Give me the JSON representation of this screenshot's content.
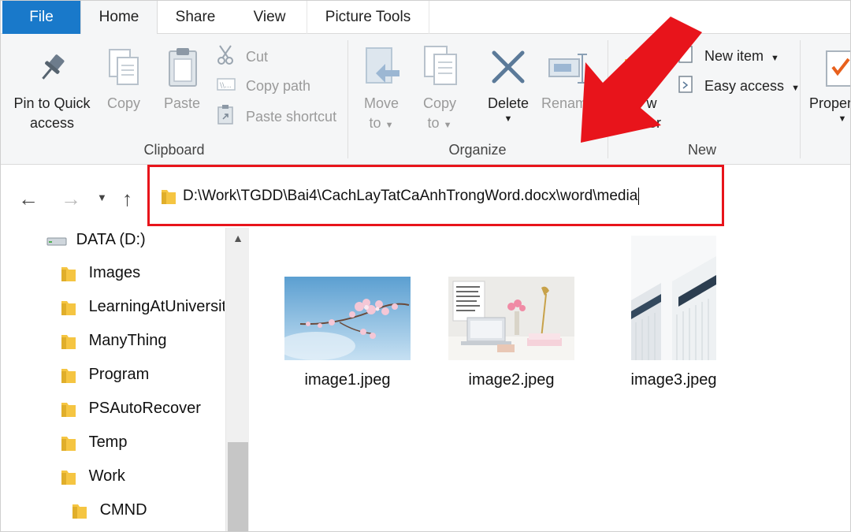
{
  "tabs": {
    "file": "File",
    "home": "Home",
    "share": "Share",
    "view": "View",
    "picture_tools": "Picture Tools"
  },
  "ribbon": {
    "clipboard": {
      "group_label": "Clipboard",
      "pin_line1": "Pin to Quick",
      "pin_line2": "access",
      "copy": "Copy",
      "paste": "Paste",
      "cut": "Cut",
      "copy_path": "Copy path",
      "paste_shortcut": "Paste shortcut"
    },
    "organize": {
      "group_label": "Organize",
      "move_line1": "Move",
      "move_line2": "to",
      "copy_line1": "Copy",
      "copy_line2": "to",
      "delete": "Delete",
      "rename": "Renam"
    },
    "new": {
      "group_label": "New",
      "new_folder_line1": "w",
      "new_folder_line2": "der",
      "new_item": "New item",
      "easy_access": "Easy access"
    },
    "open": {
      "properties": "Proper"
    }
  },
  "address": {
    "path": "D:\\Work\\TGDD\\Bai4\\CachLayTatCaAnhTrongWord.docx\\word\\media"
  },
  "nav_tree": [
    {
      "label": "DATA (D:)",
      "icon": "drive-icon"
    },
    {
      "label": "Images",
      "icon": "folder-icon"
    },
    {
      "label": "LearningAtUniversity",
      "icon": "folder-icon"
    },
    {
      "label": "ManyThing",
      "icon": "folder-icon"
    },
    {
      "label": "Program",
      "icon": "folder-icon"
    },
    {
      "label": "PSAutoRecover",
      "icon": "folder-icon"
    },
    {
      "label": "Temp",
      "icon": "folder-icon"
    },
    {
      "label": "Work",
      "icon": "folder-icon"
    },
    {
      "label": "CMND",
      "icon": "folder-icon"
    }
  ],
  "files": [
    {
      "name": "image1.jpeg"
    },
    {
      "name": "image2.jpeg"
    },
    {
      "name": "image3.jpeg"
    }
  ],
  "colors": {
    "file_tab": "#1979ca",
    "highlight": "#e8141b",
    "folder": "#f5c542"
  }
}
